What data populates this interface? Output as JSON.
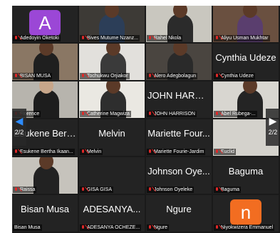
{
  "tiles": [
    {
      "name": "Adedoyin Oketoki",
      "big": "",
      "avatar": "A",
      "avatar_color": "#9b47d6"
    },
    {
      "name": "Bives Mutume Nzanz...",
      "big": ""
    },
    {
      "name": "Rahel Nkola",
      "big": ""
    },
    {
      "name": "Aliyu Usman Mukhtar",
      "big": ""
    },
    {
      "name": "BISAN MUSA",
      "big": ""
    },
    {
      "name": "Tochukwu Orjiakor",
      "big": ""
    },
    {
      "name": "Alero Adegbolagun",
      "big": ""
    },
    {
      "name": "Cynthia Udeze",
      "big": "Cynthia Udeze"
    },
    {
      "name": "Florence",
      "big": ""
    },
    {
      "name": "Catherine Magwiza",
      "big": ""
    },
    {
      "name": "JOHN HARRISON",
      "big": "JOHN HARRI..."
    },
    {
      "name": "Abel Rubega-...",
      "big": ""
    },
    {
      "name": "Esukene Bertha Ikaan...",
      "big": "Esukene Bert..."
    },
    {
      "name": "Melvin",
      "big": "Melvin"
    },
    {
      "name": "Mariette Fourie-Jardim",
      "big": "Mariette Four..."
    },
    {
      "name": "Euclid",
      "big": ""
    },
    {
      "name": "Raissa",
      "big": ""
    },
    {
      "name": "GISA GISA",
      "big": ""
    },
    {
      "name": "Johnson Oyeleke",
      "big": "Johnson Oye..."
    },
    {
      "name": "Baguma",
      "big": "Baguma"
    },
    {
      "name": "Bisan Musa",
      "big": "Bisan Musa"
    },
    {
      "name": "ADESANYA OCHEZE...",
      "big": "ADESANYA..."
    },
    {
      "name": "Ngure",
      "big": "Ngure"
    },
    {
      "name": "Niyokwizera Emmanuel",
      "big": "",
      "avatar": "n",
      "avatar_color": "#f26d21"
    }
  ],
  "nav": {
    "prev_page": "2/2",
    "next_page": "2/2"
  }
}
